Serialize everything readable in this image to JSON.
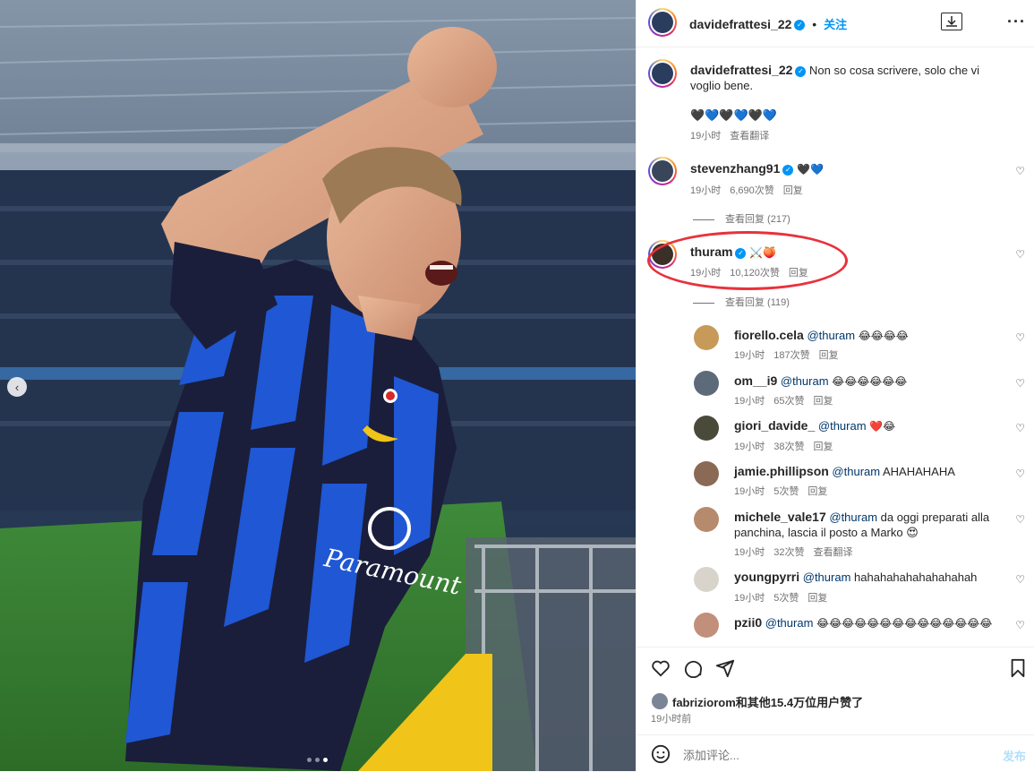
{
  "post": {
    "author": "davidefrattesi_22",
    "follow_label": "关注",
    "dot_sep": "•",
    "caption": "Non so cosa scrivere, solo che vi voglio bene.",
    "caption_emojis": "🖤💙🖤💙🖤💙",
    "caption_time": "19小时",
    "caption_translate": "查看翻译"
  },
  "comments": [
    {
      "user": "stevenzhang91",
      "text": "🖤💙",
      "time": "19小时",
      "likes": "6,690次赞",
      "reply": "回复",
      "view_replies": "查看回复 (217)"
    },
    {
      "user": "thuram",
      "text": "⚔️🍑",
      "time": "19小时",
      "likes": "10,120次赞",
      "reply": "回复",
      "view_replies": "查看回复 (119)"
    }
  ],
  "replies": [
    {
      "user": "fiorello.cela",
      "mention": "@thuram",
      "text": "😂😂😂😂",
      "time": "19小时",
      "likes": "187次赞",
      "reply": "回复"
    },
    {
      "user": "om__i9",
      "mention": "@thuram",
      "text": "😂😂😂😂😂😂",
      "time": "19小时",
      "likes": "65次赞",
      "reply": "回复"
    },
    {
      "user": "giori_davide_",
      "mention": "@thuram",
      "text": "❤️😂",
      "time": "19小时",
      "likes": "38次赞",
      "reply": "回复"
    },
    {
      "user": "jamie.phillipson",
      "mention": "@thuram",
      "text": "AHAHAHAHA",
      "time": "19小时",
      "likes": "5次赞",
      "reply": "回复"
    },
    {
      "user": "michele_vale17",
      "mention": "@thuram",
      "text": "da oggi preparati alla panchina, lascia il posto a Marko 😍",
      "time": "19小时",
      "likes": "32次赞",
      "reply": "查看翻译"
    },
    {
      "user": "youngpyrri",
      "mention": "@thuram",
      "text": "hahahahahahahahahah",
      "time": "19小时",
      "likes": "5次赞",
      "reply": "回复"
    },
    {
      "user": "pzii0",
      "mention": "@thuram",
      "text": "😂😂😂😂😂😂😂😂😂😂😂😂😂😂",
      "time": "",
      "likes": "",
      "reply": ""
    }
  ],
  "likes_summary": {
    "user": "fabriziorom",
    "rest": "和其他15.4万位用户赞了",
    "time": "19小时前"
  },
  "comment_input": {
    "placeholder": "添加评论...",
    "post_label": "发布"
  },
  "photo": {
    "jersey_text": "Paramount"
  },
  "colors": {
    "accent": "#0095f6",
    "highlight_circle": "#e8323c"
  }
}
